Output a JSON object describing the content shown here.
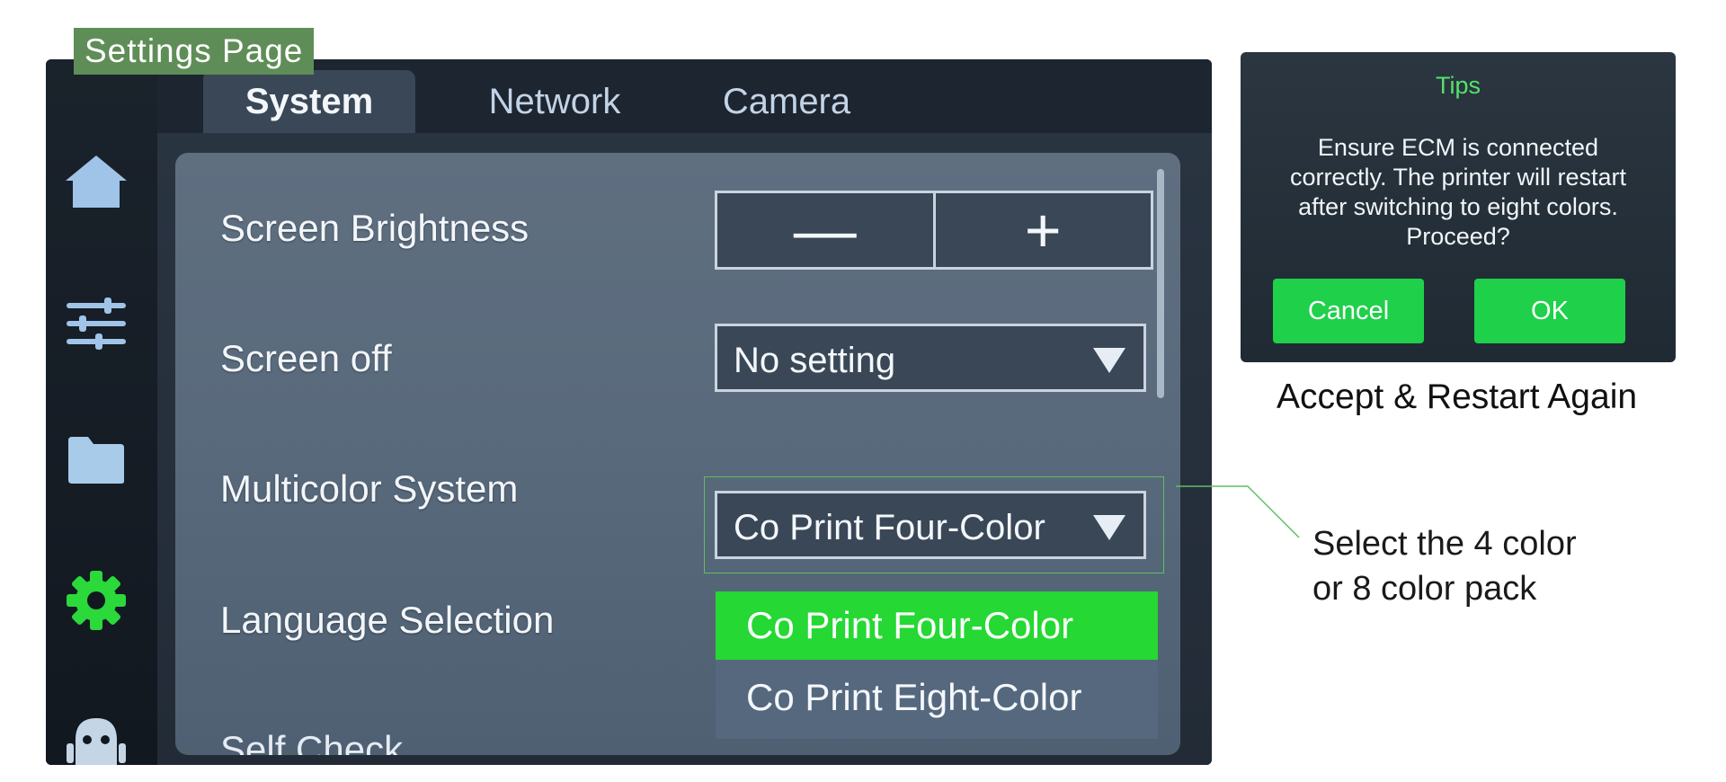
{
  "page_label": "Settings Page",
  "sidebar": {
    "icons": [
      "home-icon",
      "sliders-icon",
      "folder-icon",
      "gear-icon",
      "robot-icon"
    ],
    "active": "gear-icon",
    "active_color": "#2bd93a"
  },
  "tabs": [
    {
      "label": "System",
      "active": true
    },
    {
      "label": "Network",
      "active": false
    },
    {
      "label": "Camera",
      "active": false
    }
  ],
  "settings": {
    "screen_brightness": {
      "label": "Screen Brightness",
      "minus": "—",
      "plus": "+"
    },
    "screen_off": {
      "label": "Screen off",
      "value": "No setting"
    },
    "multicolor": {
      "label": "Multicolor System",
      "value": "Co Print Four-Color",
      "options": [
        "Co Print Four-Color",
        "Co Print Eight-Color"
      ],
      "selected_option": "Co Print Four-Color"
    },
    "language": {
      "label": "Language Selection"
    },
    "self_check": {
      "label": "Self Check"
    }
  },
  "callout": {
    "text": "Select the 4 color\nor 8 color pack"
  },
  "tips_dialog": {
    "title": "Tips",
    "message": "Ensure ECM is connected correctly. The printer will restart after switching to eight colors. Proceed?",
    "cancel": "Cancel",
    "ok": "OK",
    "caption": "Accept &  Restart Again"
  },
  "colors": {
    "accent_green": "#25d833",
    "title_bg": "#5f8d57",
    "tips_title": "#54e26b"
  }
}
